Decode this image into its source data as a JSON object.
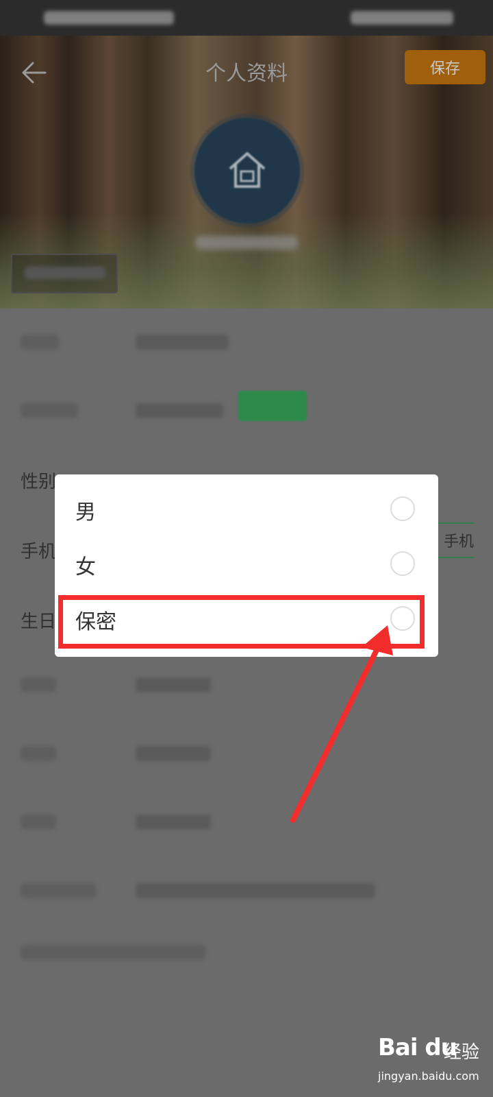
{
  "header": {
    "title": "个人资料",
    "save_label": "保存"
  },
  "list": {
    "partial_labels": {
      "gender": "性别",
      "phone": "手机",
      "birthday": "生日"
    },
    "bind_phone_label": "手机"
  },
  "gender_dialog": {
    "options": [
      {
        "label": "男",
        "selected": false
      },
      {
        "label": "女",
        "selected": false
      },
      {
        "label": "保密",
        "selected": false
      }
    ]
  },
  "watermark": {
    "brand": "Bai du",
    "suffix": "经验",
    "url": "jingyan.baidu.com"
  },
  "colors": {
    "highlight": "#f22d2b",
    "save_button": "#a05f0a",
    "verify_badge": "#2e8a4b"
  }
}
